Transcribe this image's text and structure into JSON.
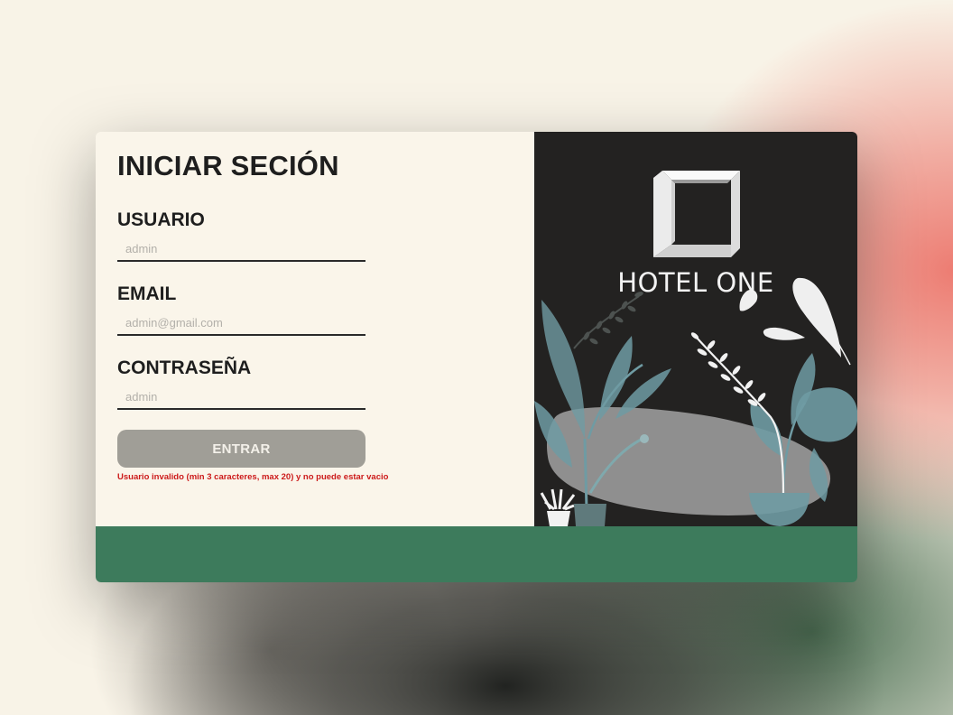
{
  "login": {
    "title": "INICIAR SECIÓN",
    "username": {
      "label": "USUARIO",
      "placeholder": "admin"
    },
    "email": {
      "label": "EMAIL",
      "placeholder": "admin@gmail.com"
    },
    "password": {
      "label": "CONTRASEÑA",
      "placeholder": "admin"
    },
    "submit_label": "ENTRAR",
    "error_message": "Usuario invalido (min 3 caracteres, max 20) y no puede estar vacio"
  },
  "brand": {
    "name": "HOTEL ONE",
    "logo_icon": "square-frame-logo-icon"
  },
  "colors": {
    "form_background": "#faf5ea",
    "image_background": "#232221",
    "footer": "#3d7b5c",
    "button": "#a09e97",
    "error": "#cc1a1a",
    "leaf": "#6f9ba3"
  }
}
